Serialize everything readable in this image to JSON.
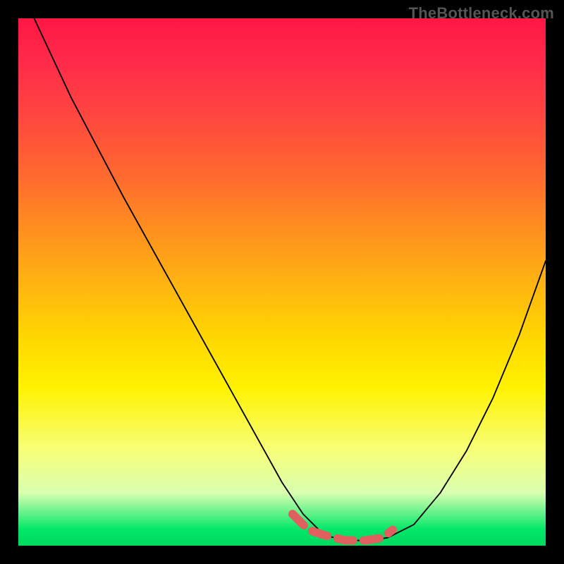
{
  "watermark": "TheBottleneck.com",
  "colors": {
    "background": "#000000",
    "curve": "#000000",
    "highlight": "#e06060",
    "gradient_top": "#ff1744",
    "gradient_bottom": "#00d85f"
  },
  "chart_data": {
    "type": "line",
    "title": "",
    "xlabel": "",
    "ylabel": "",
    "axes_visible": false,
    "xlim": [
      0,
      100
    ],
    "ylim": [
      0,
      100
    ],
    "background": "red-to-green vertical gradient",
    "series": [
      {
        "name": "bottleneck-curve",
        "x": [
          3,
          10,
          20,
          30,
          40,
          50,
          54,
          58,
          62,
          66,
          70,
          75,
          80,
          85,
          90,
          95,
          100
        ],
        "y": [
          100,
          85,
          66,
          48,
          30,
          12,
          6,
          2,
          1,
          1,
          1.5,
          4,
          10,
          18,
          28,
          40,
          54
        ]
      }
    ],
    "highlight": {
      "name": "optimal-range",
      "description": "flat valley segment drawn in salmon",
      "x": [
        52,
        55,
        58,
        62,
        66,
        69,
        71
      ],
      "y": [
        6,
        3,
        2,
        1,
        1,
        1.5,
        3
      ]
    },
    "annotations": []
  }
}
